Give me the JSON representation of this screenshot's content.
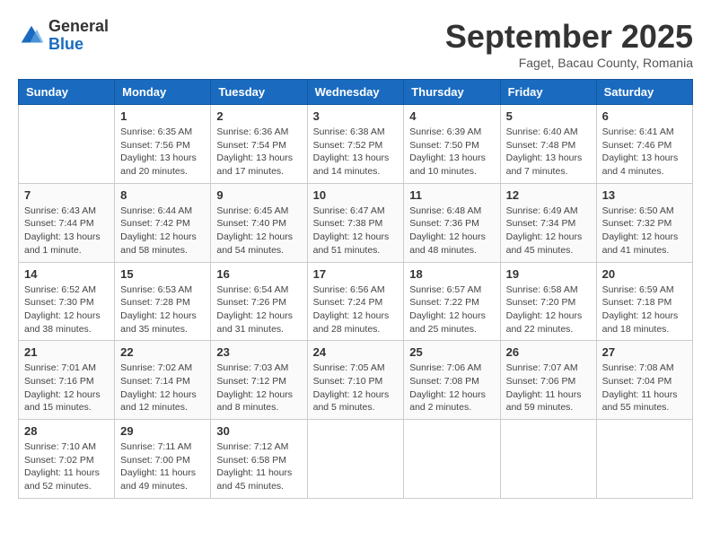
{
  "header": {
    "logo": {
      "general": "General",
      "blue": "Blue"
    },
    "title": "September 2025",
    "subtitle": "Faget, Bacau County, Romania"
  },
  "calendar": {
    "days_of_week": [
      "Sunday",
      "Monday",
      "Tuesday",
      "Wednesday",
      "Thursday",
      "Friday",
      "Saturday"
    ],
    "weeks": [
      [
        {
          "day": "",
          "sunrise": "",
          "sunset": "",
          "daylight": ""
        },
        {
          "day": "1",
          "sunrise": "Sunrise: 6:35 AM",
          "sunset": "Sunset: 7:56 PM",
          "daylight": "Daylight: 13 hours and 20 minutes."
        },
        {
          "day": "2",
          "sunrise": "Sunrise: 6:36 AM",
          "sunset": "Sunset: 7:54 PM",
          "daylight": "Daylight: 13 hours and 17 minutes."
        },
        {
          "day": "3",
          "sunrise": "Sunrise: 6:38 AM",
          "sunset": "Sunset: 7:52 PM",
          "daylight": "Daylight: 13 hours and 14 minutes."
        },
        {
          "day": "4",
          "sunrise": "Sunrise: 6:39 AM",
          "sunset": "Sunset: 7:50 PM",
          "daylight": "Daylight: 13 hours and 10 minutes."
        },
        {
          "day": "5",
          "sunrise": "Sunrise: 6:40 AM",
          "sunset": "Sunset: 7:48 PM",
          "daylight": "Daylight: 13 hours and 7 minutes."
        },
        {
          "day": "6",
          "sunrise": "Sunrise: 6:41 AM",
          "sunset": "Sunset: 7:46 PM",
          "daylight": "Daylight: 13 hours and 4 minutes."
        }
      ],
      [
        {
          "day": "7",
          "sunrise": "Sunrise: 6:43 AM",
          "sunset": "Sunset: 7:44 PM",
          "daylight": "Daylight: 13 hours and 1 minute."
        },
        {
          "day": "8",
          "sunrise": "Sunrise: 6:44 AM",
          "sunset": "Sunset: 7:42 PM",
          "daylight": "Daylight: 12 hours and 58 minutes."
        },
        {
          "day": "9",
          "sunrise": "Sunrise: 6:45 AM",
          "sunset": "Sunset: 7:40 PM",
          "daylight": "Daylight: 12 hours and 54 minutes."
        },
        {
          "day": "10",
          "sunrise": "Sunrise: 6:47 AM",
          "sunset": "Sunset: 7:38 PM",
          "daylight": "Daylight: 12 hours and 51 minutes."
        },
        {
          "day": "11",
          "sunrise": "Sunrise: 6:48 AM",
          "sunset": "Sunset: 7:36 PM",
          "daylight": "Daylight: 12 hours and 48 minutes."
        },
        {
          "day": "12",
          "sunrise": "Sunrise: 6:49 AM",
          "sunset": "Sunset: 7:34 PM",
          "daylight": "Daylight: 12 hours and 45 minutes."
        },
        {
          "day": "13",
          "sunrise": "Sunrise: 6:50 AM",
          "sunset": "Sunset: 7:32 PM",
          "daylight": "Daylight: 12 hours and 41 minutes."
        }
      ],
      [
        {
          "day": "14",
          "sunrise": "Sunrise: 6:52 AM",
          "sunset": "Sunset: 7:30 PM",
          "daylight": "Daylight: 12 hours and 38 minutes."
        },
        {
          "day": "15",
          "sunrise": "Sunrise: 6:53 AM",
          "sunset": "Sunset: 7:28 PM",
          "daylight": "Daylight: 12 hours and 35 minutes."
        },
        {
          "day": "16",
          "sunrise": "Sunrise: 6:54 AM",
          "sunset": "Sunset: 7:26 PM",
          "daylight": "Daylight: 12 hours and 31 minutes."
        },
        {
          "day": "17",
          "sunrise": "Sunrise: 6:56 AM",
          "sunset": "Sunset: 7:24 PM",
          "daylight": "Daylight: 12 hours and 28 minutes."
        },
        {
          "day": "18",
          "sunrise": "Sunrise: 6:57 AM",
          "sunset": "Sunset: 7:22 PM",
          "daylight": "Daylight: 12 hours and 25 minutes."
        },
        {
          "day": "19",
          "sunrise": "Sunrise: 6:58 AM",
          "sunset": "Sunset: 7:20 PM",
          "daylight": "Daylight: 12 hours and 22 minutes."
        },
        {
          "day": "20",
          "sunrise": "Sunrise: 6:59 AM",
          "sunset": "Sunset: 7:18 PM",
          "daylight": "Daylight: 12 hours and 18 minutes."
        }
      ],
      [
        {
          "day": "21",
          "sunrise": "Sunrise: 7:01 AM",
          "sunset": "Sunset: 7:16 PM",
          "daylight": "Daylight: 12 hours and 15 minutes."
        },
        {
          "day": "22",
          "sunrise": "Sunrise: 7:02 AM",
          "sunset": "Sunset: 7:14 PM",
          "daylight": "Daylight: 12 hours and 12 minutes."
        },
        {
          "day": "23",
          "sunrise": "Sunrise: 7:03 AM",
          "sunset": "Sunset: 7:12 PM",
          "daylight": "Daylight: 12 hours and 8 minutes."
        },
        {
          "day": "24",
          "sunrise": "Sunrise: 7:05 AM",
          "sunset": "Sunset: 7:10 PM",
          "daylight": "Daylight: 12 hours and 5 minutes."
        },
        {
          "day": "25",
          "sunrise": "Sunrise: 7:06 AM",
          "sunset": "Sunset: 7:08 PM",
          "daylight": "Daylight: 12 hours and 2 minutes."
        },
        {
          "day": "26",
          "sunrise": "Sunrise: 7:07 AM",
          "sunset": "Sunset: 7:06 PM",
          "daylight": "Daylight: 11 hours and 59 minutes."
        },
        {
          "day": "27",
          "sunrise": "Sunrise: 7:08 AM",
          "sunset": "Sunset: 7:04 PM",
          "daylight": "Daylight: 11 hours and 55 minutes."
        }
      ],
      [
        {
          "day": "28",
          "sunrise": "Sunrise: 7:10 AM",
          "sunset": "Sunset: 7:02 PM",
          "daylight": "Daylight: 11 hours and 52 minutes."
        },
        {
          "day": "29",
          "sunrise": "Sunrise: 7:11 AM",
          "sunset": "Sunset: 7:00 PM",
          "daylight": "Daylight: 11 hours and 49 minutes."
        },
        {
          "day": "30",
          "sunrise": "Sunrise: 7:12 AM",
          "sunset": "Sunset: 6:58 PM",
          "daylight": "Daylight: 11 hours and 45 minutes."
        },
        {
          "day": "",
          "sunrise": "",
          "sunset": "",
          "daylight": ""
        },
        {
          "day": "",
          "sunrise": "",
          "sunset": "",
          "daylight": ""
        },
        {
          "day": "",
          "sunrise": "",
          "sunset": "",
          "daylight": ""
        },
        {
          "day": "",
          "sunrise": "",
          "sunset": "",
          "daylight": ""
        }
      ]
    ]
  }
}
